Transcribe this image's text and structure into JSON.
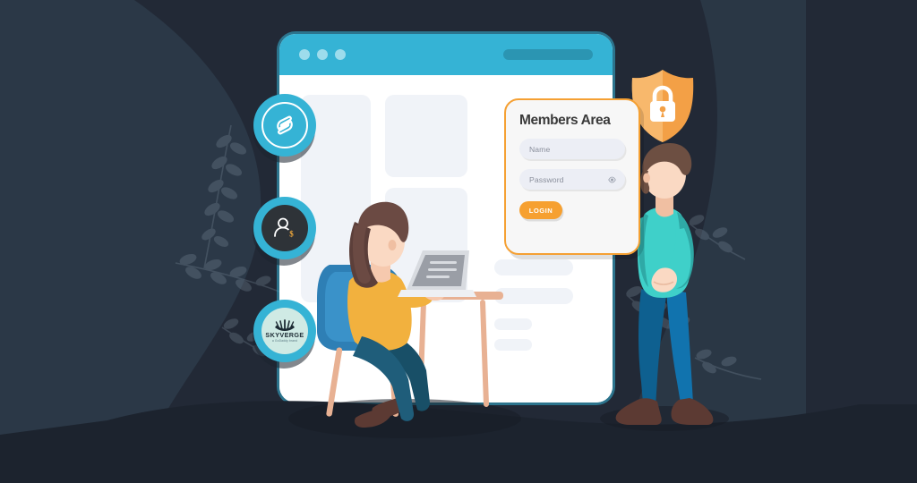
{
  "scene": {
    "title": "Members Area login illustration",
    "background_color": "#222936",
    "blob_color": "#2b3847",
    "ground_color": "#1c232e",
    "accent_teal": "#35B3D5",
    "accent_orange": "#F5A033"
  },
  "browser": {
    "titlebar_color": "#35B3D5",
    "dots": [
      "window-dot-1",
      "window-dot-2",
      "window-dot-3"
    ],
    "url_pill": "address-bar-placeholder",
    "placeholders": [
      {
        "name": "content-block-left-tall"
      },
      {
        "name": "content-block-top-right"
      },
      {
        "name": "content-block-mid-right"
      },
      {
        "name": "content-line-wide-1"
      },
      {
        "name": "content-line-wide-2"
      },
      {
        "name": "content-line-short-1"
      },
      {
        "name": "content-line-short-2"
      }
    ]
  },
  "badges": [
    {
      "name": "jilt-logo-badge",
      "icon": "jilt-mark-icon",
      "ring_color": "#35B3D5"
    },
    {
      "name": "memberships-badge",
      "icon": "user-dollar-icon",
      "ring_color": "#35B3D5",
      "inner_color": "#2e3338"
    },
    {
      "name": "skyverge-logo-badge",
      "icon": "skyverge-fan-icon",
      "ring_color": "#35B3D5",
      "inner_color": "#cfeae4",
      "brand_name": "SKYVERGE",
      "tagline": "a GoDaddy brand"
    }
  ],
  "shield": {
    "name": "security-shield",
    "icon": "padlock-icon",
    "color": "#F5A033"
  },
  "login_card": {
    "title": "Members Area",
    "border_color": "#F5A033",
    "fields": [
      {
        "name": "name-field",
        "placeholder": "Name",
        "value": ""
      },
      {
        "name": "password-field",
        "placeholder": "Password",
        "value": "",
        "icon": "eye-icon"
      }
    ],
    "submit_label": "LOGIN",
    "submit_color": "#F6A030"
  },
  "characters": [
    {
      "name": "seated-woman-with-laptop",
      "hair_color": "#5c3f3a",
      "top_color": "#F2B13E",
      "pants_color": "#1f5d7a",
      "chair_color": "#2e7fb5",
      "desk_color": "#e8b193"
    },
    {
      "name": "standing-man-pointing",
      "hair_color": "#6d4f42",
      "shirt_color": "#3FD0C9",
      "pants_color": "#1173AE",
      "shoe_color": "#5c3a33"
    }
  ]
}
